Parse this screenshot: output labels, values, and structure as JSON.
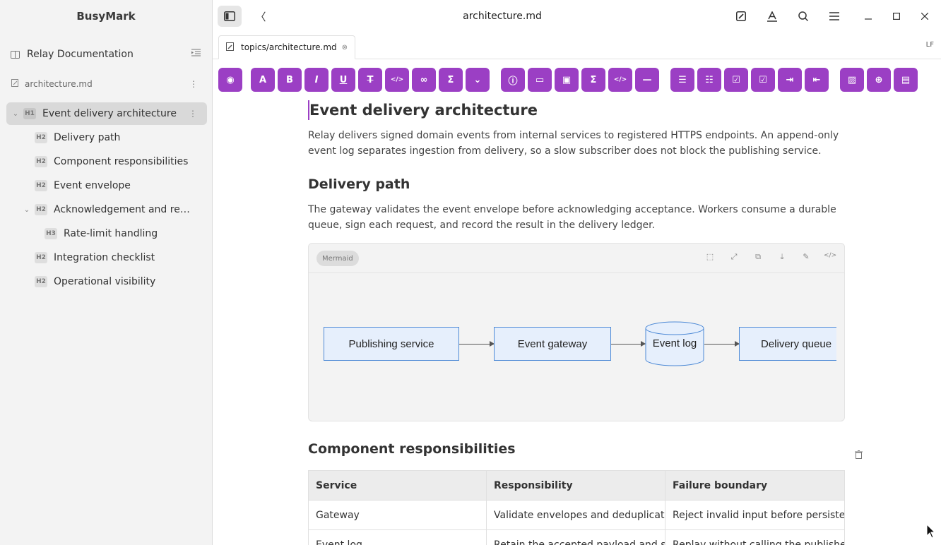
{
  "app": {
    "name": "BusyMark"
  },
  "sidebar": {
    "project": "Relay Documentation",
    "file": "architecture.md",
    "outline": [
      {
        "level": "H1",
        "label": "Event delivery architecture",
        "active": true
      },
      {
        "level": "H2",
        "label": "Delivery path"
      },
      {
        "level": "H2",
        "label": "Component responsibilities"
      },
      {
        "level": "H2",
        "label": "Event envelope"
      },
      {
        "level": "H2",
        "label": "Acknowledgement and re…"
      },
      {
        "level": "H3",
        "label": "Rate-limit handling"
      },
      {
        "level": "H2",
        "label": "Integration checklist"
      },
      {
        "level": "H2",
        "label": "Operational visibility"
      }
    ]
  },
  "header": {
    "title": "architecture.md"
  },
  "tabs": [
    {
      "label": "topics/architecture.md"
    }
  ],
  "status": {
    "line_ending": "LF"
  },
  "doc": {
    "h1": "Event delivery architecture",
    "intro": "Relay delivers signed domain events from internal services to registered HTTPS endpoints. An append-only event log separates ingestion from delivery, so a slow subscriber does not block the publishing service.",
    "h2_delivery": "Delivery path",
    "delivery_text": "The gateway validates the event envelope before acknowledging acceptance. Workers consume a durable queue, sign each request, and record the result in the delivery ledger.",
    "diagram": {
      "tag": "Mermaid",
      "nodes": [
        "Publishing service",
        "Event gateway",
        "Event log",
        "Delivery queue"
      ]
    },
    "h2_components": "Component responsibilities",
    "table": {
      "headers": [
        "Service",
        "Responsibility",
        "Failure boundary"
      ],
      "rows": [
        [
          "Gateway",
          "Validate envelopes and deduplicate",
          "Reject invalid input before persister"
        ],
        [
          "Event log",
          "Retain the accepted payload and sc",
          "Replay without calling the publisher"
        ]
      ]
    }
  },
  "colors": {
    "accent": "#9b3fc4",
    "node_border": "#4e8ad6",
    "node_fill": "#e6effc"
  }
}
